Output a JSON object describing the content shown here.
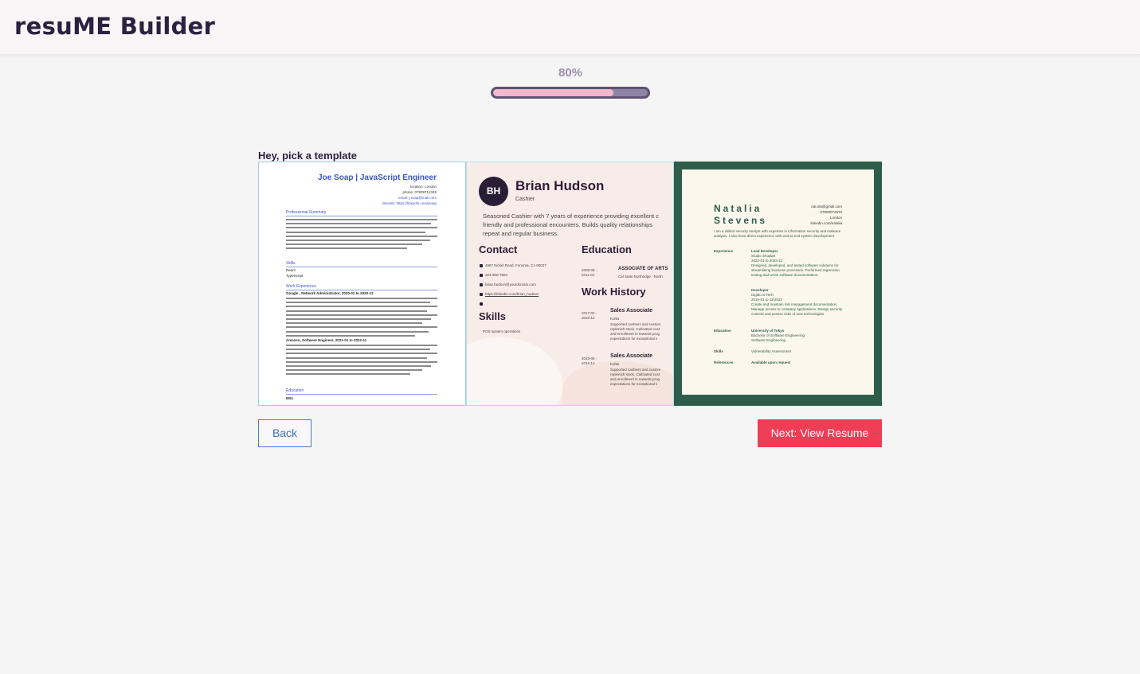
{
  "header": {
    "brand": "resuME Builder"
  },
  "progress": {
    "label": "80%",
    "value": 0.78
  },
  "picker": {
    "title": "Hey, pick a template"
  },
  "templates": [
    {
      "name_title": "Joe Soap | JavaScript Engineer",
      "contact": [
        "location: London",
        "phone: 07809712345",
        "email: j.soap@mail.com",
        "linkedin: https://linkedin.com/jsoap"
      ],
      "sections": {
        "summary": "Professional Summary",
        "skills": "Skills",
        "skills_items": [
          "React",
          "TypeScript"
        ],
        "work": "Work Experience",
        "job1": "Google , Network Administrator, 2020-01 to 2020-12",
        "job2": "Amazon, Software Engineer, 2021-01 to 2022-11",
        "education": "Education",
        "education_item": "MSc"
      }
    },
    {
      "initials": "BH",
      "name": "Brian Hudson",
      "role": "Cashier",
      "summary_lines": [
        "Seasoned Cashier with 7 years of experience providing excellent c",
        "friendly and professional encounters. Builds quality relationships",
        "repeat and regular business."
      ],
      "contact_heading": "Contact",
      "contact": [
        "4567 Nickel Road, Fonoma, CA 90027",
        "323-900-7684",
        "brian.hudson@yourdomain.com",
        "https://linkedin.com/brian_hudson"
      ],
      "skills_heading": "Skills",
      "skills_item": "POS system operations",
      "education_heading": "Education",
      "education_degree": "ASSOCIATE OF ARTS",
      "education_school": "Cal State Northridge - North",
      "education_dates": "2009-09 - 2011-04",
      "work_heading": "Work History",
      "jobs": [
        {
          "title": "Sales Associate",
          "company": "Kohls",
          "dates": "2017-02 - 2019-12",
          "desc": [
            "Supported cashiers and custom",
            "replenish stock. Cultivated cust",
            "and enrollment in rewards prog",
            "expectations for exceptional s"
          ]
        },
        {
          "title": "Sales Associate",
          "company": "Kohls",
          "dates": "2013-05 - 2016-12",
          "desc": [
            "Supported cashiers and custom",
            "replenish stock. Cultivated cust",
            "and enrollment in rewards prog",
            "expectations for exceptional s"
          ]
        }
      ]
    },
    {
      "first_name": "Natalia",
      "last_name": "Stevens",
      "contact": [
        "nat.sta@gmail.com",
        "07900072570",
        "London",
        "linkedin.com/natalia"
      ],
      "intro": "I am a skilled security analyst with expertise in information security and malware analysis. I also have direct experience with end-to-end system development.",
      "experience_label": "Experience",
      "jobs": [
        {
          "title": "Lead Developer",
          "company": "Studio Shodwe",
          "dates": "2022-01 to 2023-12",
          "desc": "Designed, developed, and tested software solutions for streamlining business processes. Performed regression testing and wrote software documentation."
        },
        {
          "title": "Developer",
          "company": "Digitto is Tech",
          "dates": "2019-01 to 12/2022",
          "desc": "Create and maintain risk management documentation. Manage access to company applications. Design security controls and assess risks of new technologies."
        }
      ],
      "education_label": "Education",
      "education_school": "University of Tokyo",
      "education_degree": "Bachelor of Software Engineering",
      "education_field": "Software Engineering",
      "skills_label": "Skills",
      "skills_value": "Vulnerability Assessment",
      "references_label": "References",
      "references_value": "Available upon request"
    }
  ],
  "buttons": {
    "back": "Back",
    "next": "Next: View Resume"
  },
  "colors": {
    "brand": "#2b2140",
    "accent": "#ef3d55",
    "progress_fill": "#f3b8cb",
    "template3_frame": "#2e5d4c"
  }
}
